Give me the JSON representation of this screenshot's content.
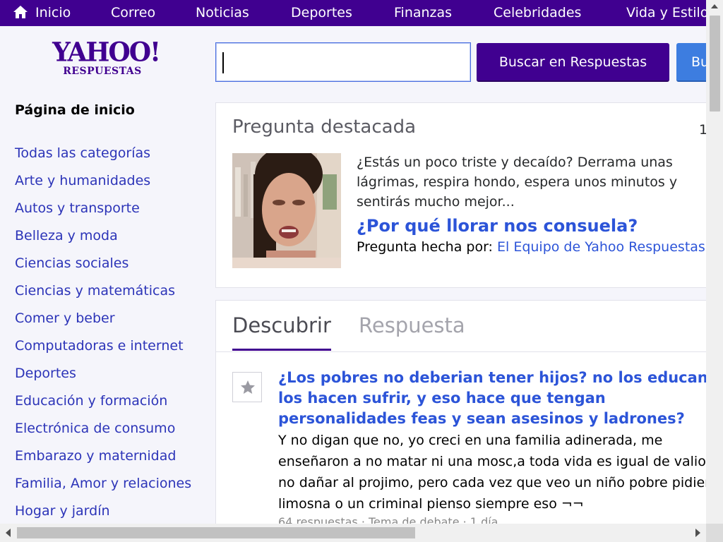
{
  "nav": {
    "items": [
      {
        "label": "Inicio",
        "icon": "home-icon"
      },
      {
        "label": "Correo"
      },
      {
        "label": "Noticias"
      },
      {
        "label": "Deportes"
      },
      {
        "label": "Finanzas"
      },
      {
        "label": "Celebridades"
      },
      {
        "label": "Vida y Estilo"
      }
    ]
  },
  "logo": {
    "brand": "YAHOO!",
    "product": "RESPUESTAS"
  },
  "search": {
    "value": "",
    "button_label": "Buscar en Respuestas",
    "button2_label": "Buscar en la Web"
  },
  "sidebar": {
    "home_label": "Página de inicio",
    "categories": [
      "Todas las categorías",
      "Arte y humanidades",
      "Autos y transporte",
      "Belleza y moda",
      "Ciencias sociales",
      "Ciencias y matemáticas",
      "Comer y beber",
      "Computadoras e internet",
      "Deportes",
      "Educación y formación",
      "Electrónica de consumo",
      "Embarazo y maternidad",
      "Familia, Amor y relaciones",
      "Hogar y jardín"
    ]
  },
  "featured": {
    "heading": "Pregunta destacada",
    "count": "1",
    "text": "¿Estás un poco triste y decaído? Derrama unas lágrimas, respira hondo, espera unos minutos y sentirás mucho mejor...",
    "question": "¿Por qué llorar nos consuela?",
    "asked_by_label": "Pregunta hecha por:",
    "author": "El Equipo de Yahoo Respuestas"
  },
  "discover": {
    "tabs": [
      {
        "label": "Descubrir",
        "active": true
      },
      {
        "label": "Respuesta",
        "active": false
      }
    ],
    "question": {
      "title": "¿Los pobres no deberian tener hijos? no los educan, los hacen sufrir, y eso hace que tengan personalidades feas y sean asesinos y ladrones?",
      "body": "Y no digan que no, yo creci en una familia adinerada, me enseñaron a no matar ni una mosc,a toda vida es igual de valiosa, no dañar al projimo, pero cada vez que veo un niño pobre pidiendo limosna o un criminal pienso siempre eso ¬¬",
      "meta": "64 respuestas · Tema de debate · 1 día"
    }
  },
  "colors": {
    "brand_purple": "#400090",
    "link_blue": "#2c54d8",
    "category_blue": "#2c34b8",
    "web_button_blue": "#3d7de0"
  }
}
